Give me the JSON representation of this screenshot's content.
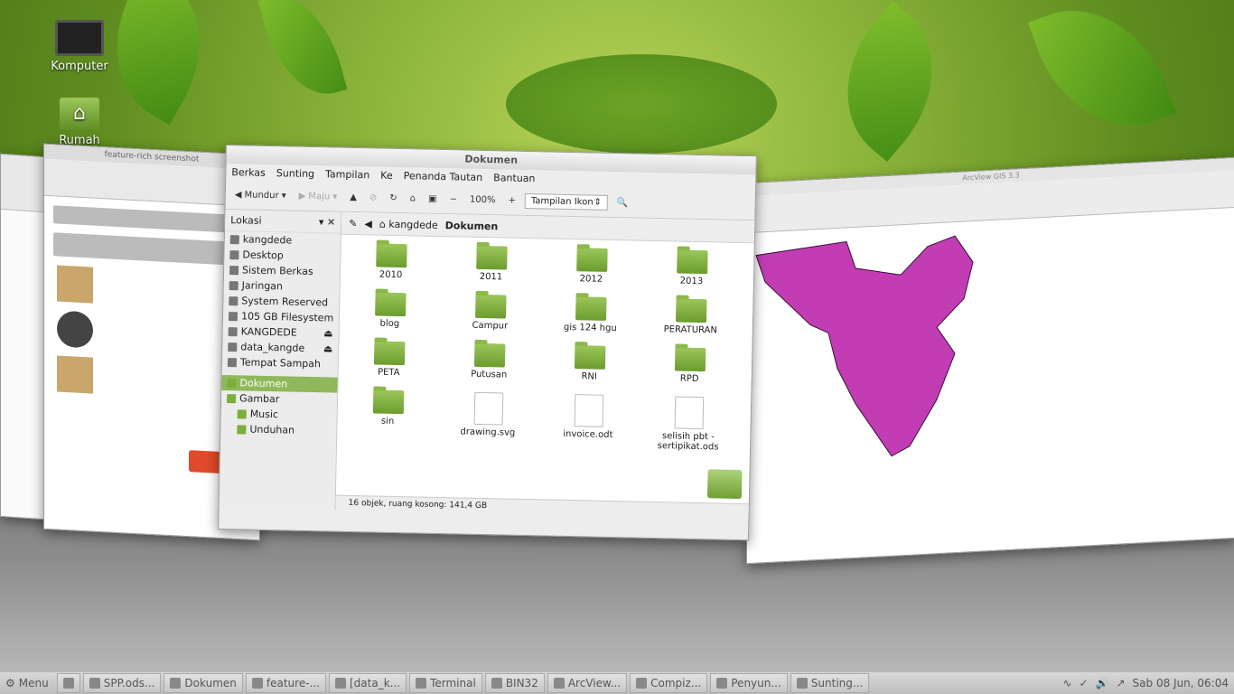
{
  "desktop": {
    "icons": [
      {
        "label": "Komputer",
        "icon": "monitor-icon"
      },
      {
        "label": "Rumah kangdede",
        "icon": "home-folder-icon"
      }
    ]
  },
  "background_windows": {
    "browser_title": "feature-rich screenshot",
    "arcview_title": "ArcView GIS 3.3"
  },
  "file_manager": {
    "title": "Dokumen",
    "menu": [
      "Berkas",
      "Sunting",
      "Tampilan",
      "Ke",
      "Penanda Tautan",
      "Bantuan"
    ],
    "toolbar": {
      "back": "Mundur",
      "forward": "Maju",
      "zoom": "100%",
      "view_mode": "Tampilan Ikon"
    },
    "sidebar": {
      "header": "Lokasi",
      "items": [
        {
          "label": "kangdede"
        },
        {
          "label": "Desktop"
        },
        {
          "label": "Sistem Berkas"
        },
        {
          "label": "Jaringan"
        },
        {
          "label": "System Reserved"
        },
        {
          "label": "105 GB Filesystem"
        },
        {
          "label": "KANGDEDE"
        },
        {
          "label": "data_kangde"
        },
        {
          "label": "Tempat Sampah"
        },
        {
          "label": "Dokumen"
        },
        {
          "label": "Gambar"
        },
        {
          "label": "Music"
        },
        {
          "label": "Unduhan"
        }
      ]
    },
    "breadcrumb": {
      "parent": "kangdede",
      "current": "Dokumen"
    },
    "files": [
      {
        "name": "2010",
        "kind": "folder"
      },
      {
        "name": "2011",
        "kind": "folder"
      },
      {
        "name": "2012",
        "kind": "folder"
      },
      {
        "name": "2013",
        "kind": "folder"
      },
      {
        "name": "blog",
        "kind": "folder"
      },
      {
        "name": "Campur",
        "kind": "folder"
      },
      {
        "name": "gis 124 hgu",
        "kind": "folder"
      },
      {
        "name": "PERATURAN",
        "kind": "folder"
      },
      {
        "name": "PETA",
        "kind": "folder"
      },
      {
        "name": "Putusan",
        "kind": "folder"
      },
      {
        "name": "RNI",
        "kind": "folder"
      },
      {
        "name": "RPD",
        "kind": "folder"
      },
      {
        "name": "sin",
        "kind": "folder"
      },
      {
        "name": "drawing.svg",
        "kind": "svg"
      },
      {
        "name": "invoice.odt",
        "kind": "odt"
      },
      {
        "name": "selisih pbt - sertipikat.ods",
        "kind": "ods"
      }
    ],
    "status": "16 objek, ruang kosong: 141,4 GB"
  },
  "taskbar": {
    "menu_label": "Menu",
    "buttons": [
      "SPP.ods...",
      "Dokumen",
      "feature-...",
      "[data_k...",
      "Terminal",
      "BIN32",
      "ArcView...",
      "Compiz...",
      "Penyun...",
      "Sunting..."
    ],
    "clock": "Sab 08 Jun, 06:04"
  },
  "colors": {
    "accent": "#8fb85a",
    "map_fill": "#c23cb4"
  }
}
